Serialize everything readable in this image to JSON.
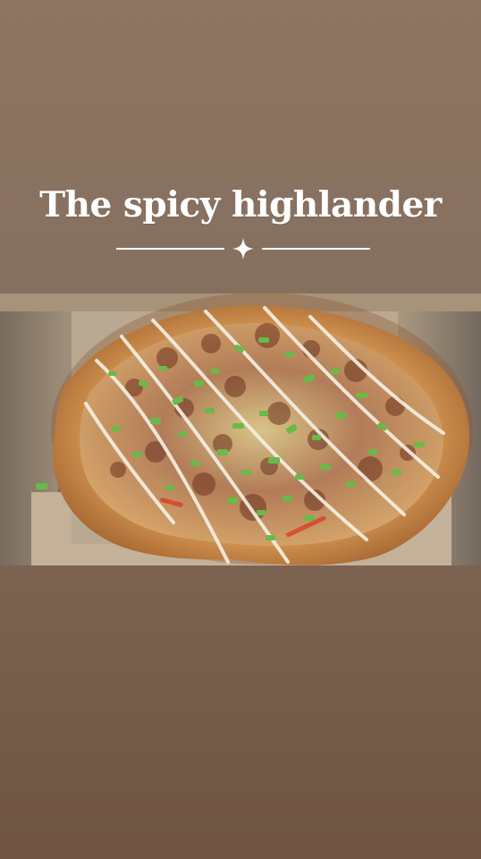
{
  "story": {
    "title": "The spicy highlander",
    "background_top": "#8e7462",
    "background_bottom": "#6f5442"
  },
  "image": {
    "subject": "pizza in a cardboard box",
    "icon": "sparkle-divider-icon"
  }
}
